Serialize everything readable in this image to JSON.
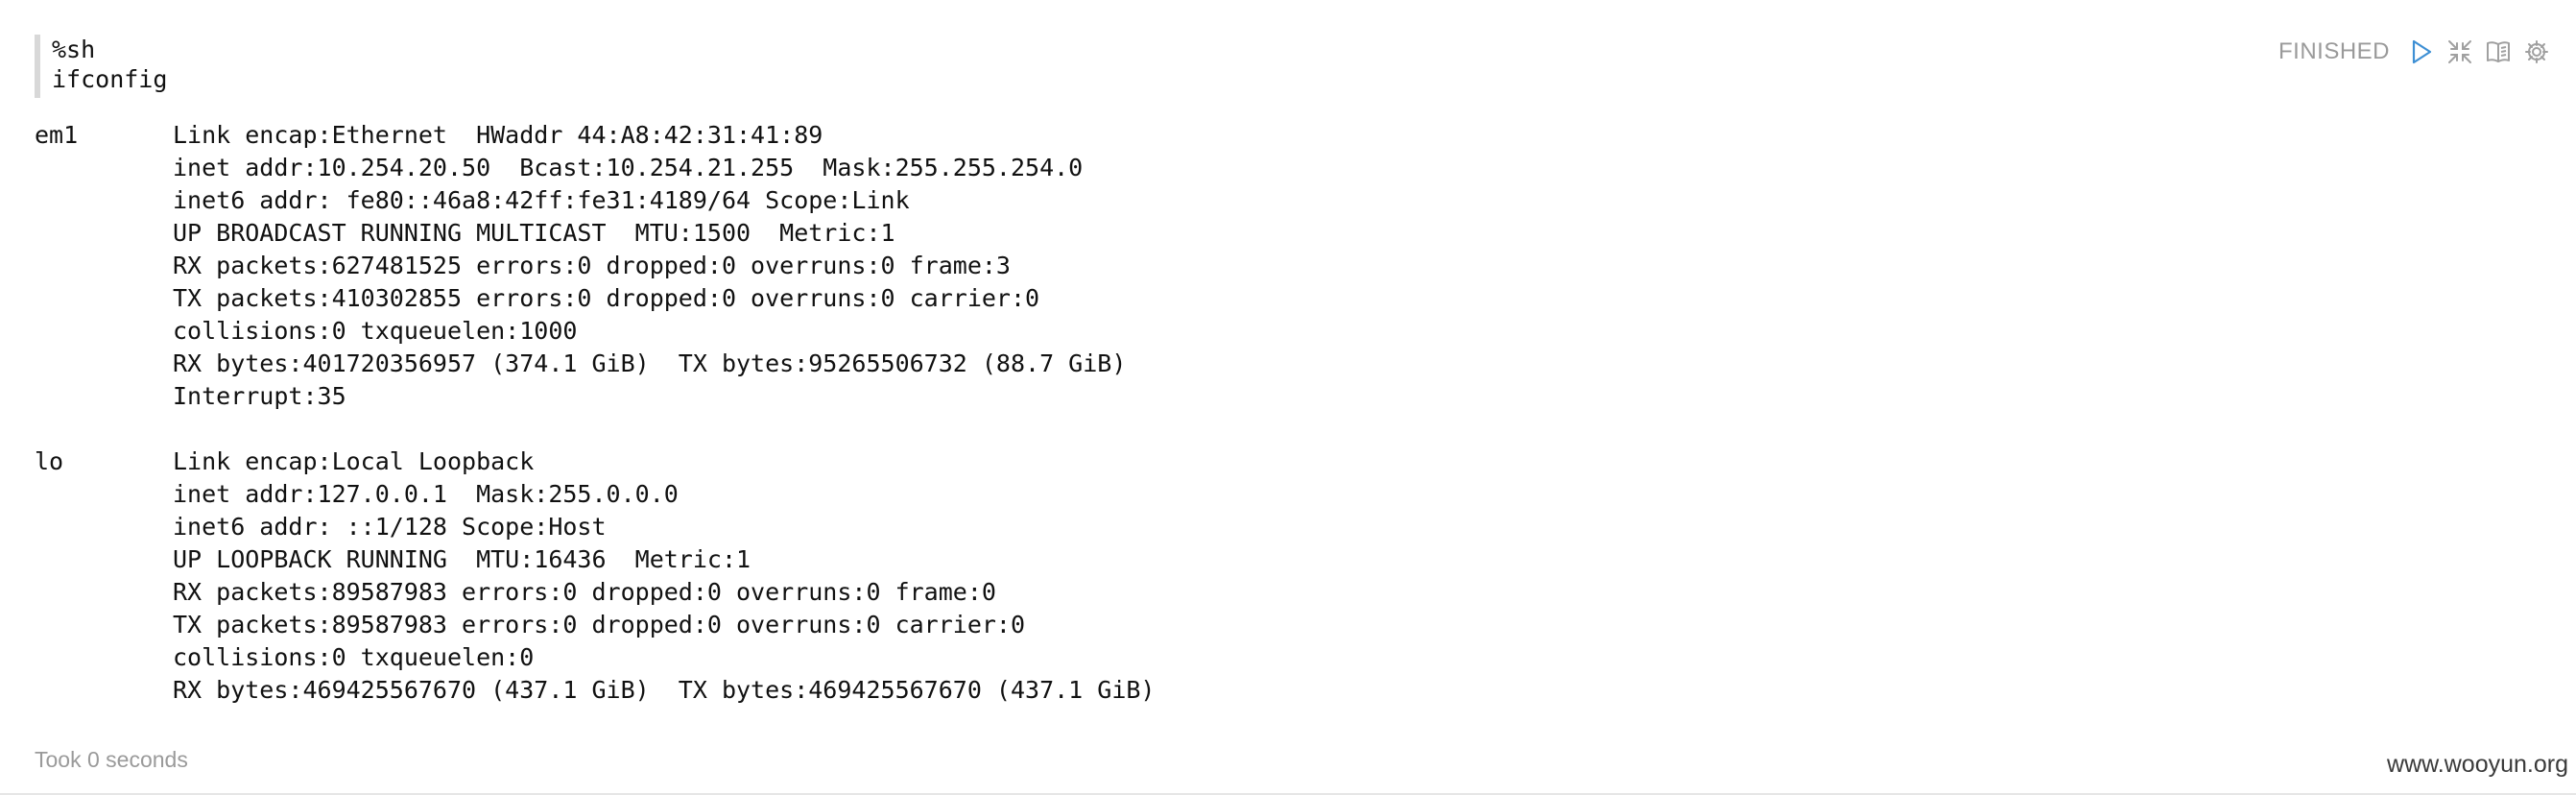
{
  "editor": {
    "lines": [
      "%sh",
      "ifconfig"
    ]
  },
  "controls": {
    "status": "FINISHED",
    "icons": [
      "play-icon",
      "collapse-icon",
      "book-icon",
      "gear-icon"
    ],
    "accent": "#3d8fd4",
    "icon_gray": "#a0a0a0"
  },
  "output": {
    "interfaces": [
      {
        "name": "em1",
        "lines": [
          "Link encap:Ethernet  HWaddr 44:A8:42:31:41:89",
          "inet addr:10.254.20.50  Bcast:10.254.21.255  Mask:255.255.254.0",
          "inet6 addr: fe80::46a8:42ff:fe31:4189/64 Scope:Link",
          "UP BROADCAST RUNNING MULTICAST  MTU:1500  Metric:1",
          "RX packets:627481525 errors:0 dropped:0 overruns:0 frame:3",
          "TX packets:410302855 errors:0 dropped:0 overruns:0 carrier:0",
          "collisions:0 txqueuelen:1000",
          "RX bytes:401720356957 (374.1 GiB)  TX bytes:95265506732 (88.7 GiB)",
          "Interrupt:35"
        ]
      },
      {
        "name": "lo",
        "lines": [
          "Link encap:Local Loopback",
          "inet addr:127.0.0.1  Mask:255.0.0.0",
          "inet6 addr: ::1/128 Scope:Host",
          "UP LOOPBACK RUNNING  MTU:16436  Metric:1",
          "RX packets:89587983 errors:0 dropped:0 overruns:0 frame:0",
          "TX packets:89587983 errors:0 dropped:0 overruns:0 carrier:0",
          "collisions:0 txqueuelen:0",
          "RX bytes:469425567670 (437.1 GiB)  TX bytes:469425567670 (437.1 GiB)"
        ]
      }
    ]
  },
  "footer": {
    "took": "Took 0 seconds",
    "watermark": "www.wooyun.org"
  }
}
